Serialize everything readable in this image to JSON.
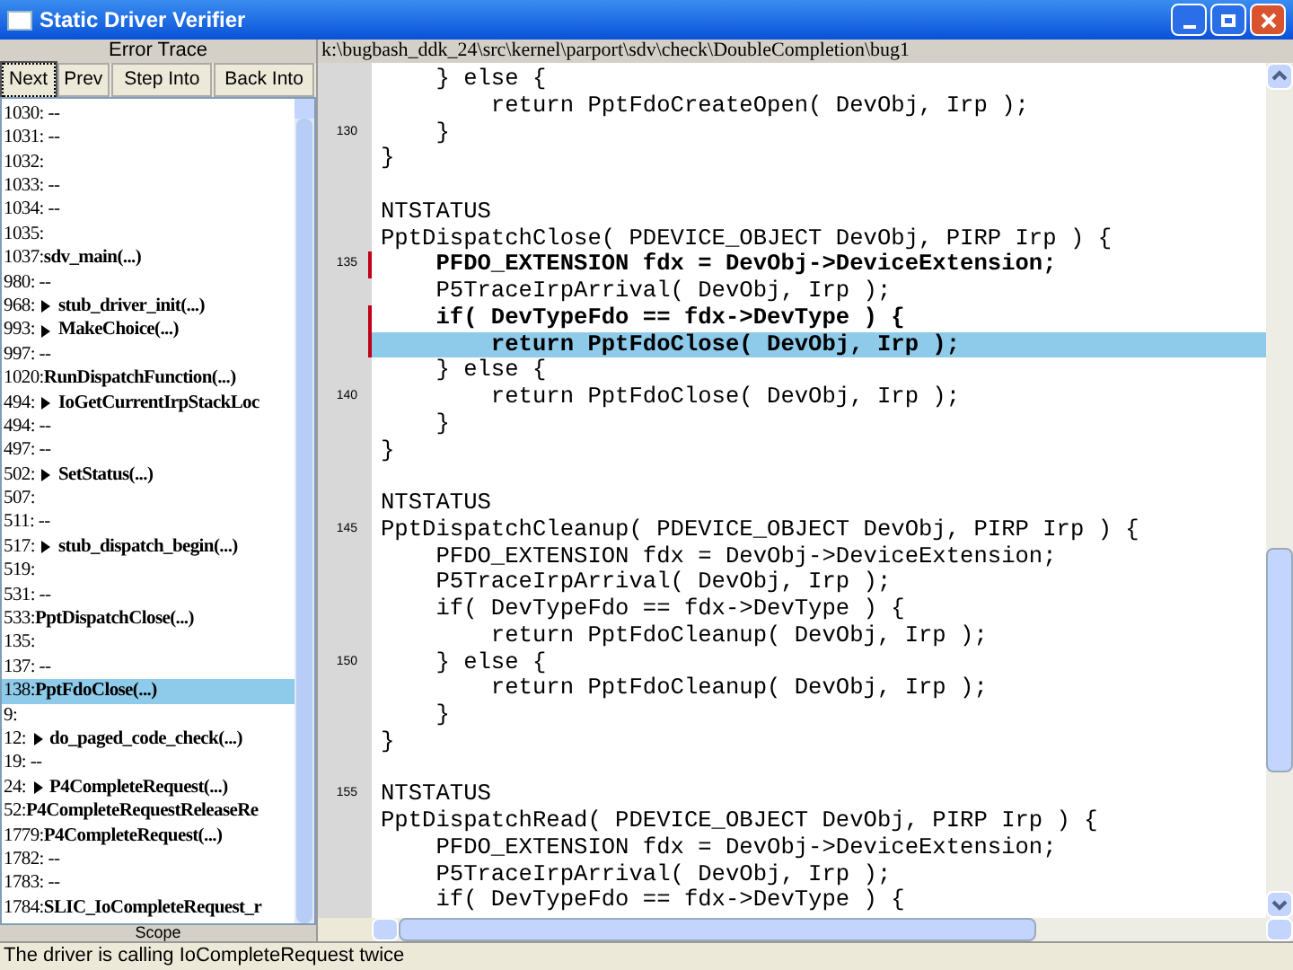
{
  "window": {
    "title": "Static Driver Verifier"
  },
  "trace_panel": {
    "title": "Error Trace",
    "buttons": [
      {
        "label": "Next",
        "selected": true
      },
      {
        "label": "Prev",
        "selected": false
      },
      {
        "label": "Step Into",
        "selected": false
      },
      {
        "label": "Back Into",
        "selected": false
      }
    ],
    "items": [
      {
        "line": "1030: --",
        "selected": false
      },
      {
        "line": "1031: --",
        "selected": false
      },
      {
        "line": "1032:",
        "selected": false
      },
      {
        "line": "1033: --",
        "selected": false
      },
      {
        "line": "1034: --",
        "selected": false
      },
      {
        "line": "1035:",
        "selected": false
      },
      {
        "line": "1037:",
        "call": "sdv_main(...)",
        "expandable": false,
        "selected": false
      },
      {
        "line": "980: --",
        "selected": false
      },
      {
        "line": "968:",
        "call": "stub_driver_init(...)",
        "expandable": true,
        "selected": false
      },
      {
        "line": "993:",
        "call": "MakeChoice(...)",
        "expandable": true,
        "selected": false
      },
      {
        "line": "997: --",
        "selected": false
      },
      {
        "line": "1020:",
        "call": "RunDispatchFunction(...)",
        "expandable": false,
        "selected": false
      },
      {
        "line": "494:",
        "call": "IoGetCurrentIrpStackLoc",
        "expandable": true,
        "selected": false
      },
      {
        "line": "494: --",
        "selected": false
      },
      {
        "line": "497: --",
        "selected": false
      },
      {
        "line": "502:",
        "call": "SetStatus(...)",
        "expandable": true,
        "selected": false
      },
      {
        "line": "507:",
        "selected": false
      },
      {
        "line": "511: --",
        "selected": false
      },
      {
        "line": "517:",
        "call": "stub_dispatch_begin(...)",
        "expandable": true,
        "selected": false
      },
      {
        "line": "519:",
        "selected": false
      },
      {
        "line": "531: --",
        "selected": false
      },
      {
        "line": "533:",
        "call": "PptDispatchClose(...)",
        "expandable": false,
        "selected": false
      },
      {
        "line": "135:",
        "selected": false
      },
      {
        "line": "137: --",
        "selected": false
      },
      {
        "line": "138:",
        "call": "PptFdoClose(...)",
        "expandable": false,
        "selected": true
      },
      {
        "line": "9:",
        "selected": false
      },
      {
        "line": "12:",
        "call": "do_paged_code_check(...)",
        "expandable": true,
        "selected": false
      },
      {
        "line": "19: --",
        "selected": false
      },
      {
        "line": "24:",
        "call": "P4CompleteRequest(...)",
        "expandable": true,
        "selected": false
      },
      {
        "line": "52:",
        "call": "P4CompleteRequestReleaseRe",
        "expandable": false,
        "selected": false
      },
      {
        "line": "1779:",
        "call": "P4CompleteRequest(...)",
        "expandable": false,
        "selected": false
      },
      {
        "line": "1782: --",
        "selected": false
      },
      {
        "line": "1783: --",
        "selected": false
      },
      {
        "line": "1784:",
        "call": "SLIC_IoCompleteRequest_r",
        "expandable": false,
        "selected": false
      }
    ],
    "footer": "Scope"
  },
  "source_panel": {
    "path": "k:\\bugbash_ddk_24\\src\\kernel\\parport\\sdv\\check\\DoubleCompletion\\bug1",
    "blocks": [
      {
        "lines": [
          {
            "text": "    } else {",
            "bold": false,
            "selected": false,
            "marked": false
          },
          {
            "text": "        return PptFdoCreateOpen( DevObj, Irp );",
            "bold": false,
            "selected": false,
            "marked": false
          },
          {
            "text": "    }",
            "bold": false,
            "selected": false,
            "marked": false,
            "number": "130"
          },
          {
            "text": "}",
            "bold": false,
            "selected": false,
            "marked": false
          }
        ]
      },
      {
        "lines": [
          {
            "text": "NTSTATUS",
            "bold": false,
            "selected": false,
            "marked": false
          },
          {
            "text": "PptDispatchClose( PDEVICE_OBJECT DevObj, PIRP Irp ) {",
            "bold": false,
            "selected": false,
            "marked": false
          },
          {
            "text": "    PFDO_EXTENSION fdx = DevObj->DeviceExtension;",
            "bold": true,
            "selected": false,
            "marked": true,
            "number": "135"
          },
          {
            "text": "    P5TraceIrpArrival( DevObj, Irp );",
            "bold": false,
            "selected": false,
            "marked": false
          },
          {
            "text": "    if( DevTypeFdo == fdx->DevType ) {",
            "bold": true,
            "selected": false,
            "marked": true
          },
          {
            "text": "        return PptFdoClose( DevObj, Irp );",
            "bold": true,
            "selected": true,
            "marked": true
          },
          {
            "text": "    } else {",
            "bold": false,
            "selected": false,
            "marked": false
          },
          {
            "text": "        return PptFdoClose( DevObj, Irp );",
            "bold": false,
            "selected": false,
            "marked": false,
            "number": "140"
          },
          {
            "text": "    }",
            "bold": false,
            "selected": false,
            "marked": false
          },
          {
            "text": "}",
            "bold": false,
            "selected": false,
            "marked": false
          }
        ]
      },
      {
        "lines": [
          {
            "text": "NTSTATUS",
            "bold": false,
            "selected": false,
            "marked": false
          },
          {
            "text": "PptDispatchCleanup( PDEVICE_OBJECT DevObj, PIRP Irp ) {",
            "bold": false,
            "selected": false,
            "marked": false,
            "number": "145"
          },
          {
            "text": "    PFDO_EXTENSION fdx = DevObj->DeviceExtension;",
            "bold": false,
            "selected": false,
            "marked": false
          },
          {
            "text": "    P5TraceIrpArrival( DevObj, Irp );",
            "bold": false,
            "selected": false,
            "marked": false
          },
          {
            "text": "    if( DevTypeFdo == fdx->DevType ) {",
            "bold": false,
            "selected": false,
            "marked": false
          },
          {
            "text": "        return PptFdoCleanup( DevObj, Irp );",
            "bold": false,
            "selected": false,
            "marked": false
          },
          {
            "text": "    } else {",
            "bold": false,
            "selected": false,
            "marked": false,
            "number": "150"
          },
          {
            "text": "        return PptFdoCleanup( DevObj, Irp );",
            "bold": false,
            "selected": false,
            "marked": false
          },
          {
            "text": "    }",
            "bold": false,
            "selected": false,
            "marked": false
          },
          {
            "text": "}",
            "bold": false,
            "selected": false,
            "marked": false
          }
        ]
      },
      {
        "lines": [
          {
            "text": "NTSTATUS",
            "bold": false,
            "selected": false,
            "marked": false,
            "number": "155"
          },
          {
            "text": "PptDispatchRead( PDEVICE_OBJECT DevObj, PIRP Irp ) {",
            "bold": false,
            "selected": false,
            "marked": false
          },
          {
            "text": "    PFDO_EXTENSION fdx = DevObj->DeviceExtension;",
            "bold": false,
            "selected": false,
            "marked": false
          },
          {
            "text": "    P5TraceIrpArrival( DevObj, Irp );",
            "bold": false,
            "selected": false,
            "marked": false
          },
          {
            "text": "    if( DevTypeFdo == fdx->DevType ) {",
            "bold": false,
            "selected": false,
            "marked": false
          }
        ]
      }
    ]
  },
  "status_bar": "The driver is calling IoCompleteRequest twice"
}
